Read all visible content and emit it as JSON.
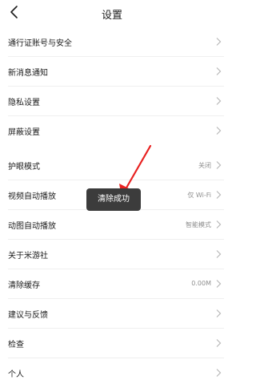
{
  "header": {
    "back_icon": "chevron-left-icon",
    "title": "设置"
  },
  "settings": {
    "rows": [
      {
        "label": "通行证账号与安全",
        "value": ""
      },
      {
        "label": "新消息通知",
        "value": ""
      },
      {
        "label": "隐私设置",
        "value": ""
      },
      {
        "label": "屏蔽设置",
        "value": ""
      },
      {
        "label": "护眼模式",
        "value": "关闭"
      },
      {
        "label": "视频自动播放",
        "value": "仅 Wi-Fi"
      },
      {
        "label": "动图自动播放",
        "value": "智能模式"
      },
      {
        "label": "关于米游社",
        "value": ""
      },
      {
        "label": "清除缓存",
        "value": "0.00M"
      },
      {
        "label": "建议与反馈",
        "value": ""
      },
      {
        "label": "检查",
        "value": ""
      },
      {
        "label": "个人",
        "value": ""
      }
    ],
    "chevron_icon": "chevron-right-icon"
  },
  "toast": {
    "text": "清除成功"
  },
  "annotation": {
    "arrow_icon": "red-arrow-icon",
    "color": "#e8201f"
  }
}
